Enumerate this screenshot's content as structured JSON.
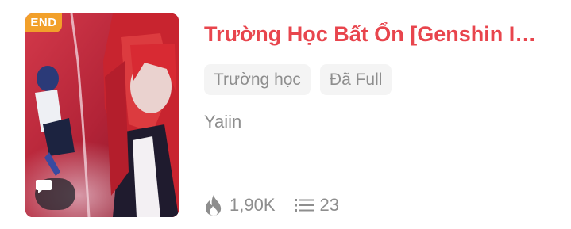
{
  "story": {
    "badge": "END",
    "title": "Trường Học Bất Ổn [Genshin Im…",
    "tags": [
      "Trường học",
      "Đã Full"
    ],
    "author": "Yaiin",
    "views": "1,90K",
    "chapters": "23"
  },
  "icons": {
    "views": "fire-icon",
    "chapters": "list-icon",
    "comment": "chat-bubble-icon"
  },
  "colors": {
    "title": "#e8454d",
    "badge": "#f2a02a",
    "meta_text": "#8e8e8e",
    "tag_bg": "#f4f4f4"
  }
}
